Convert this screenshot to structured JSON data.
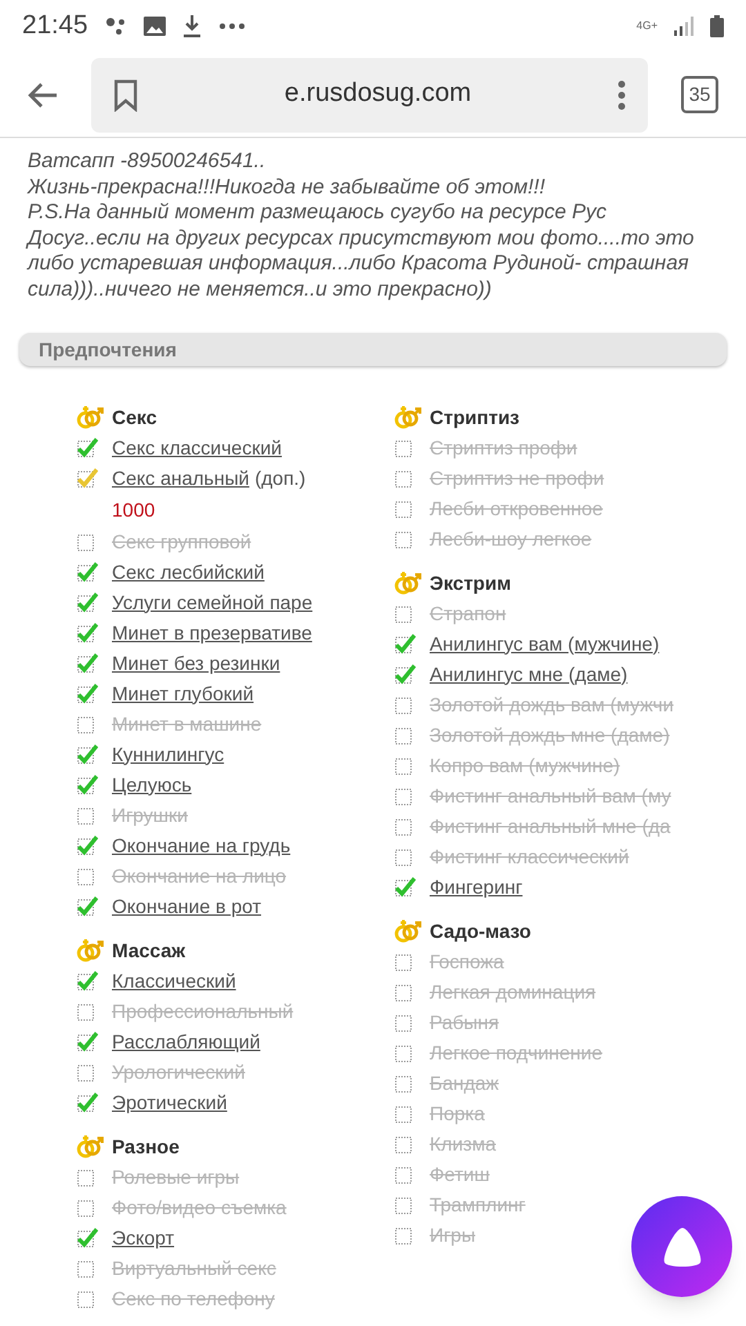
{
  "status_bar": {
    "time": "21:45",
    "network": "4G+"
  },
  "browser": {
    "url": "e.rusdosug.com",
    "tab_count": "35"
  },
  "description": [
    "Ватсапп -89500246541..",
    "Жизнь-прекрасна!!!Никогда не забывайте об этом!!!",
    "P.S.На данный момент размещаюсь сугубо на ресурсе Рус Досуг..если на других ресурсах присутствуют мои фото....то это либо устаревшая информация...либо Красота Рудиной- страшная сила)))..ничего не меняется..и это прекрасно))"
  ],
  "section_title": "Предпочтения",
  "columns": [
    [
      {
        "title": "Секс",
        "items": [
          {
            "label": "Секс классический",
            "kind": "included",
            "checked": true
          },
          {
            "label": "Секс анальный",
            "note": "(доп.)",
            "price": "1000",
            "kind": "extra",
            "checked": true
          },
          {
            "label": "Секс групповой",
            "kind": "included",
            "checked": false
          },
          {
            "label": "Секс лесбийский",
            "kind": "included",
            "checked": true
          },
          {
            "label": "Услуги семейной паре",
            "kind": "included",
            "checked": true
          },
          {
            "label": "Минет в презервативе",
            "kind": "included",
            "checked": true
          },
          {
            "label": "Минет без резинки",
            "kind": "included",
            "checked": true
          },
          {
            "label": "Минет глубокий",
            "kind": "included",
            "checked": true
          },
          {
            "label": "Минет в машине",
            "kind": "included",
            "checked": false
          },
          {
            "label": "Куннилингус",
            "kind": "included",
            "checked": true
          },
          {
            "label": "Целуюсь",
            "kind": "included",
            "checked": true
          },
          {
            "label": "Игрушки",
            "kind": "included",
            "checked": false
          },
          {
            "label": "Окончание на грудь",
            "kind": "included",
            "checked": true
          },
          {
            "label": "Окончание на лицо",
            "kind": "included",
            "checked": false
          },
          {
            "label": "Окончание в рот",
            "kind": "included",
            "checked": true
          }
        ]
      },
      {
        "title": "Массаж",
        "items": [
          {
            "label": "Классический",
            "kind": "included",
            "checked": true
          },
          {
            "label": "Профессиональный",
            "kind": "included",
            "checked": false
          },
          {
            "label": "Расслабляющий",
            "kind": "included",
            "checked": true
          },
          {
            "label": "Урологический",
            "kind": "included",
            "checked": false
          },
          {
            "label": "Эротический",
            "kind": "included",
            "checked": true
          }
        ]
      },
      {
        "title": "Разное",
        "items": [
          {
            "label": "Ролевые игры",
            "kind": "included",
            "checked": false
          },
          {
            "label": "Фото/видео съемка",
            "kind": "included",
            "checked": false
          },
          {
            "label": "Эскорт",
            "kind": "included",
            "checked": true
          },
          {
            "label": "Виртуальный секс",
            "kind": "included",
            "checked": false
          },
          {
            "label": "Секс по телефону",
            "kind": "included",
            "checked": false
          }
        ]
      }
    ],
    [
      {
        "title": "Стриптиз",
        "items": [
          {
            "label": "Стриптиз профи",
            "kind": "included",
            "checked": false
          },
          {
            "label": "Стриптиз не профи",
            "kind": "included",
            "checked": false
          },
          {
            "label": "Лесби откровенное",
            "kind": "included",
            "checked": false
          },
          {
            "label": "Лесби-шоу легкое",
            "kind": "included",
            "checked": false
          }
        ]
      },
      {
        "title": "Экстрим",
        "items": [
          {
            "label": "Страпон",
            "kind": "included",
            "checked": false
          },
          {
            "label": "Анилингус вам (мужчине)",
            "kind": "included",
            "checked": true
          },
          {
            "label": "Анилингус мне (даме)",
            "kind": "included",
            "checked": true
          },
          {
            "label": "Золотой дождь вам (мужчи",
            "kind": "included",
            "checked": false
          },
          {
            "label": "Золотой дождь мне (даме)",
            "kind": "included",
            "checked": false
          },
          {
            "label": "Копро вам (мужчине)",
            "kind": "included",
            "checked": false
          },
          {
            "label": "Фистинг анальный вам (му",
            "kind": "included",
            "checked": false
          },
          {
            "label": "Фистинг анальный мне (да",
            "kind": "included",
            "checked": false
          },
          {
            "label": "Фистинг классический",
            "kind": "included",
            "checked": false
          },
          {
            "label": "Фингеринг",
            "kind": "included",
            "checked": true
          }
        ]
      },
      {
        "title": "Садо-мазо",
        "items": [
          {
            "label": "Госпожа",
            "kind": "included",
            "checked": false
          },
          {
            "label": "Легкая доминация",
            "kind": "included",
            "checked": false
          },
          {
            "label": "Рабыня",
            "kind": "included",
            "checked": false
          },
          {
            "label": "Легкое подчинение",
            "kind": "included",
            "checked": false
          },
          {
            "label": "Бандаж",
            "kind": "included",
            "checked": false
          },
          {
            "label": "Порка",
            "kind": "included",
            "checked": false
          },
          {
            "label": "Клизма",
            "kind": "included",
            "checked": false
          },
          {
            "label": "Фетиш",
            "kind": "included",
            "checked": false
          },
          {
            "label": "Трамплинг",
            "kind": "included",
            "checked": false
          },
          {
            "label": "Игры",
            "kind": "included",
            "checked": false
          }
        ]
      }
    ]
  ]
}
